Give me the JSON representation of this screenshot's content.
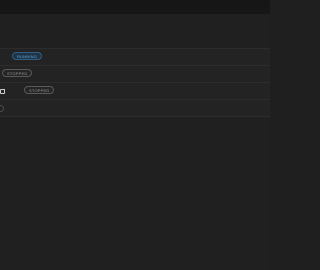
{
  "services": [
    {
      "name": "",
      "status": "RUNNING",
      "has_link_icon": false,
      "link_icon": "external-link-icon"
    },
    {
      "name": "",
      "status": "STOPPED",
      "has_link_icon": false,
      "link_icon": "external-link-icon"
    },
    {
      "name": "ts",
      "status": "STOPPED",
      "has_link_icon": true,
      "link_icon": "external-link-icon"
    },
    {
      "name": "",
      "status": "",
      "has_link_icon": false,
      "link_icon": ""
    }
  ],
  "colors": {
    "running": "#5aa9e6",
    "stopped": "#9a9a9a",
    "background": "#202020"
  }
}
